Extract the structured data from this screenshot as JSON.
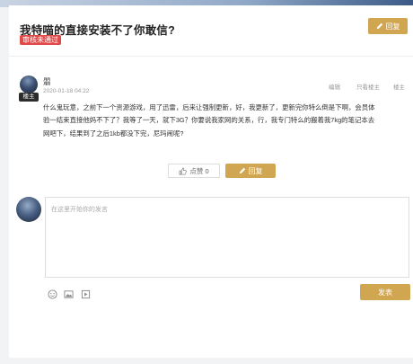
{
  "thread": {
    "title": "我特喵的直接安装不了你敢信?",
    "status_badge": "审核未通过",
    "reply_label": "回复"
  },
  "post": {
    "author": "朤",
    "host_tag": "楼主",
    "date": "2020-01-18 04:22",
    "actions": {
      "edit": "编辑",
      "host_only": "只看楼主",
      "floor": "楼主"
    },
    "content": "什么鬼玩意，之前下一个资源游戏，用了迅雷，后来让强制更新，好，我更新了，更新完你特么倒是下啊，会员体验一结束直接他妈不下了？我等了一天，就下3G？你要说我家网的关系，行，我专门特么的搬着我7kg的笔记本去网吧下，结果到了之后1kb都没下完，尼玛闹呢?",
    "like_label": "点赞 0",
    "reply_label": "回复"
  },
  "editor": {
    "placeholder": "在这里开始你的发言",
    "send_label": "发表"
  },
  "colors": {
    "accent": "#d1a651",
    "badge": "#e24a4a"
  },
  "icons": [
    "edit-icon",
    "thumbs-up-icon",
    "emoji-icon",
    "image-icon",
    "video-icon"
  ]
}
